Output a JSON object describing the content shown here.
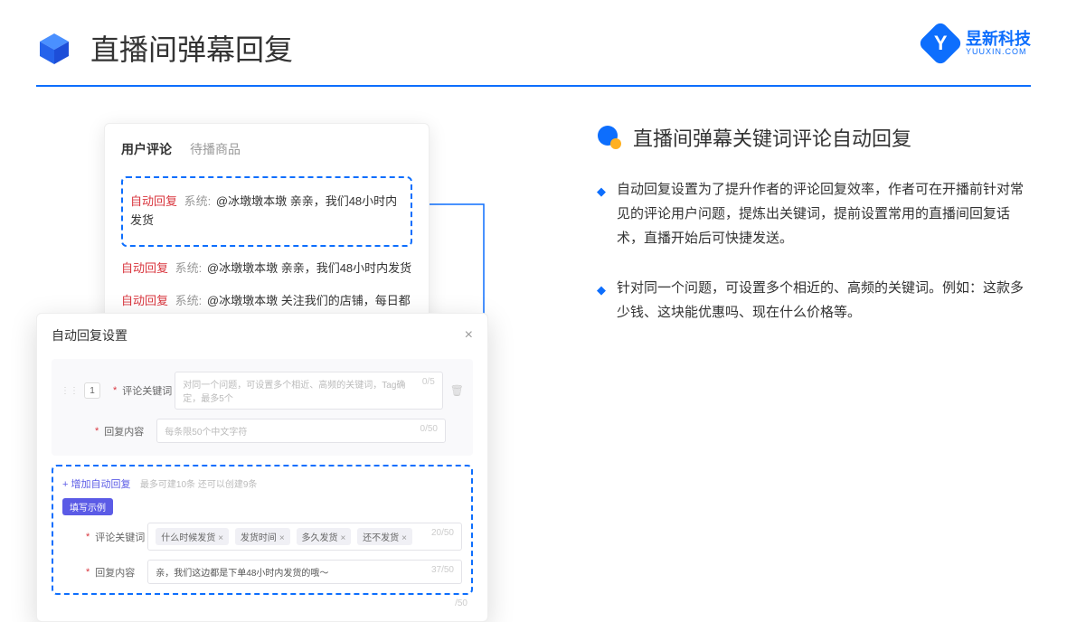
{
  "header": {
    "title": "直播间弹幕回复",
    "logo_cn": "昱新科技",
    "logo_en": "YUUXIN.COM",
    "logo_mark": "Y"
  },
  "screenTop": {
    "tabs": {
      "active": "用户评论",
      "inactive": "待播商品"
    },
    "highlighted": {
      "auto": "自动回复",
      "sys": "系统:",
      "text": "@冰墩墩本墩 亲亲，我们48小时内发货"
    },
    "row2": {
      "auto": "自动回复",
      "sys": "系统:",
      "text": "@冰墩墩本墩 亲亲，我们48小时内发货"
    },
    "row3": {
      "auto": "自动回复",
      "sys": "系统:",
      "text": "@冰墩墩本墩 关注我们的店铺，每日都有热门推荐呦～"
    }
  },
  "screenBottom": {
    "title": "自动回复设置",
    "order": "1",
    "kw_label": "评论关键词",
    "kw_placeholder": "对同一个问题，可设置多个相近、高频的关键词，Tag确定，最多5个",
    "kw_count": "0/5",
    "content_label": "回复内容",
    "content_placeholder": "每条限50个中文字符",
    "content_count": "0/50",
    "add_link": "+ 增加自动回复",
    "add_hint": "最多可建10条 还可以创建9条",
    "example_badge": "填写示例",
    "ex_kw_label": "评论关键词",
    "ex_tags": [
      "什么时候发货",
      "发货时间",
      "多久发货",
      "还不发货"
    ],
    "ex_kw_count": "20/50",
    "ex_content_label": "回复内容",
    "ex_content": "亲，我们这边都是下单48小时内发货的哦～",
    "ex_content_count": "37/50",
    "outer_count": "/50"
  },
  "right": {
    "section_title": "直播间弹幕关键词评论自动回复",
    "bullets": [
      "自动回复设置为了提升作者的评论回复效率，作者可在开播前针对常见的评论用户问题，提炼出关键词，提前设置常用的直播间回复话术，直播开始后可快捷发送。",
      "针对同一个问题，可设置多个相近的、高频的关键词。例如：这款多少钱、这块能优惠吗、现在什么价格等。"
    ]
  }
}
